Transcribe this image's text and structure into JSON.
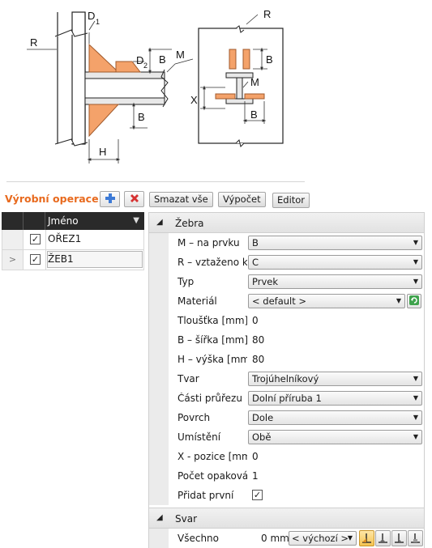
{
  "diagram": {
    "labels": {
      "r_left": "R",
      "d1_main": "D",
      "d1_sub": "1",
      "d2_main": "D",
      "d2_sub": "2",
      "b_top": "B",
      "m_left": "M",
      "b_bottom": "B",
      "h": "H",
      "r_right": "R",
      "b_right": "B",
      "m_right": "M",
      "x": "X",
      "b_right_bottom": "B"
    }
  },
  "toolbar": {
    "title": "Výrobní operace",
    "delete_all": "Smazat vše",
    "calculate": "Výpočet",
    "editor": "Editor"
  },
  "grid": {
    "header_name": "Jméno",
    "rows": [
      {
        "name": "OŘEZ1",
        "checked": true,
        "selected": false
      },
      {
        "name": "ŽEB1",
        "checked": true,
        "selected": true
      }
    ]
  },
  "props": {
    "rib_section": "Žebra",
    "m_label": "M – na prvku",
    "m_value": "B",
    "r_label": "R – vztaženo k",
    "r_value": "C",
    "type_label": "Typ",
    "type_value": "Prvek",
    "material_label": "Materiál",
    "material_value": "< default >",
    "thickness_label": "Tloušťka [mm]",
    "thickness_value": "0",
    "width_label": "B – šířka [mm]",
    "width_value": "80",
    "height_label": "H – výška [mm]",
    "height_value": "80",
    "shape_label": "Tvar",
    "shape_value": "Trojúhelníkový",
    "parts_label": "Části průřezu",
    "parts_value": "Dolní příruba 1",
    "surface_label": "Povrch",
    "surface_value": "Dole",
    "placement_label": "Umístění",
    "placement_value": "Obě",
    "xpos_label": "X - pozice [mm",
    "xpos_value": "0",
    "count_label": "Počet opakován",
    "count_value": "1",
    "addfirst_label": "Přidat první",
    "addfirst_checked": true,
    "weld_section": "Svar",
    "all_label": "Všechno",
    "all_value": "0 mm",
    "weld_default": "< výchozí >"
  }
}
